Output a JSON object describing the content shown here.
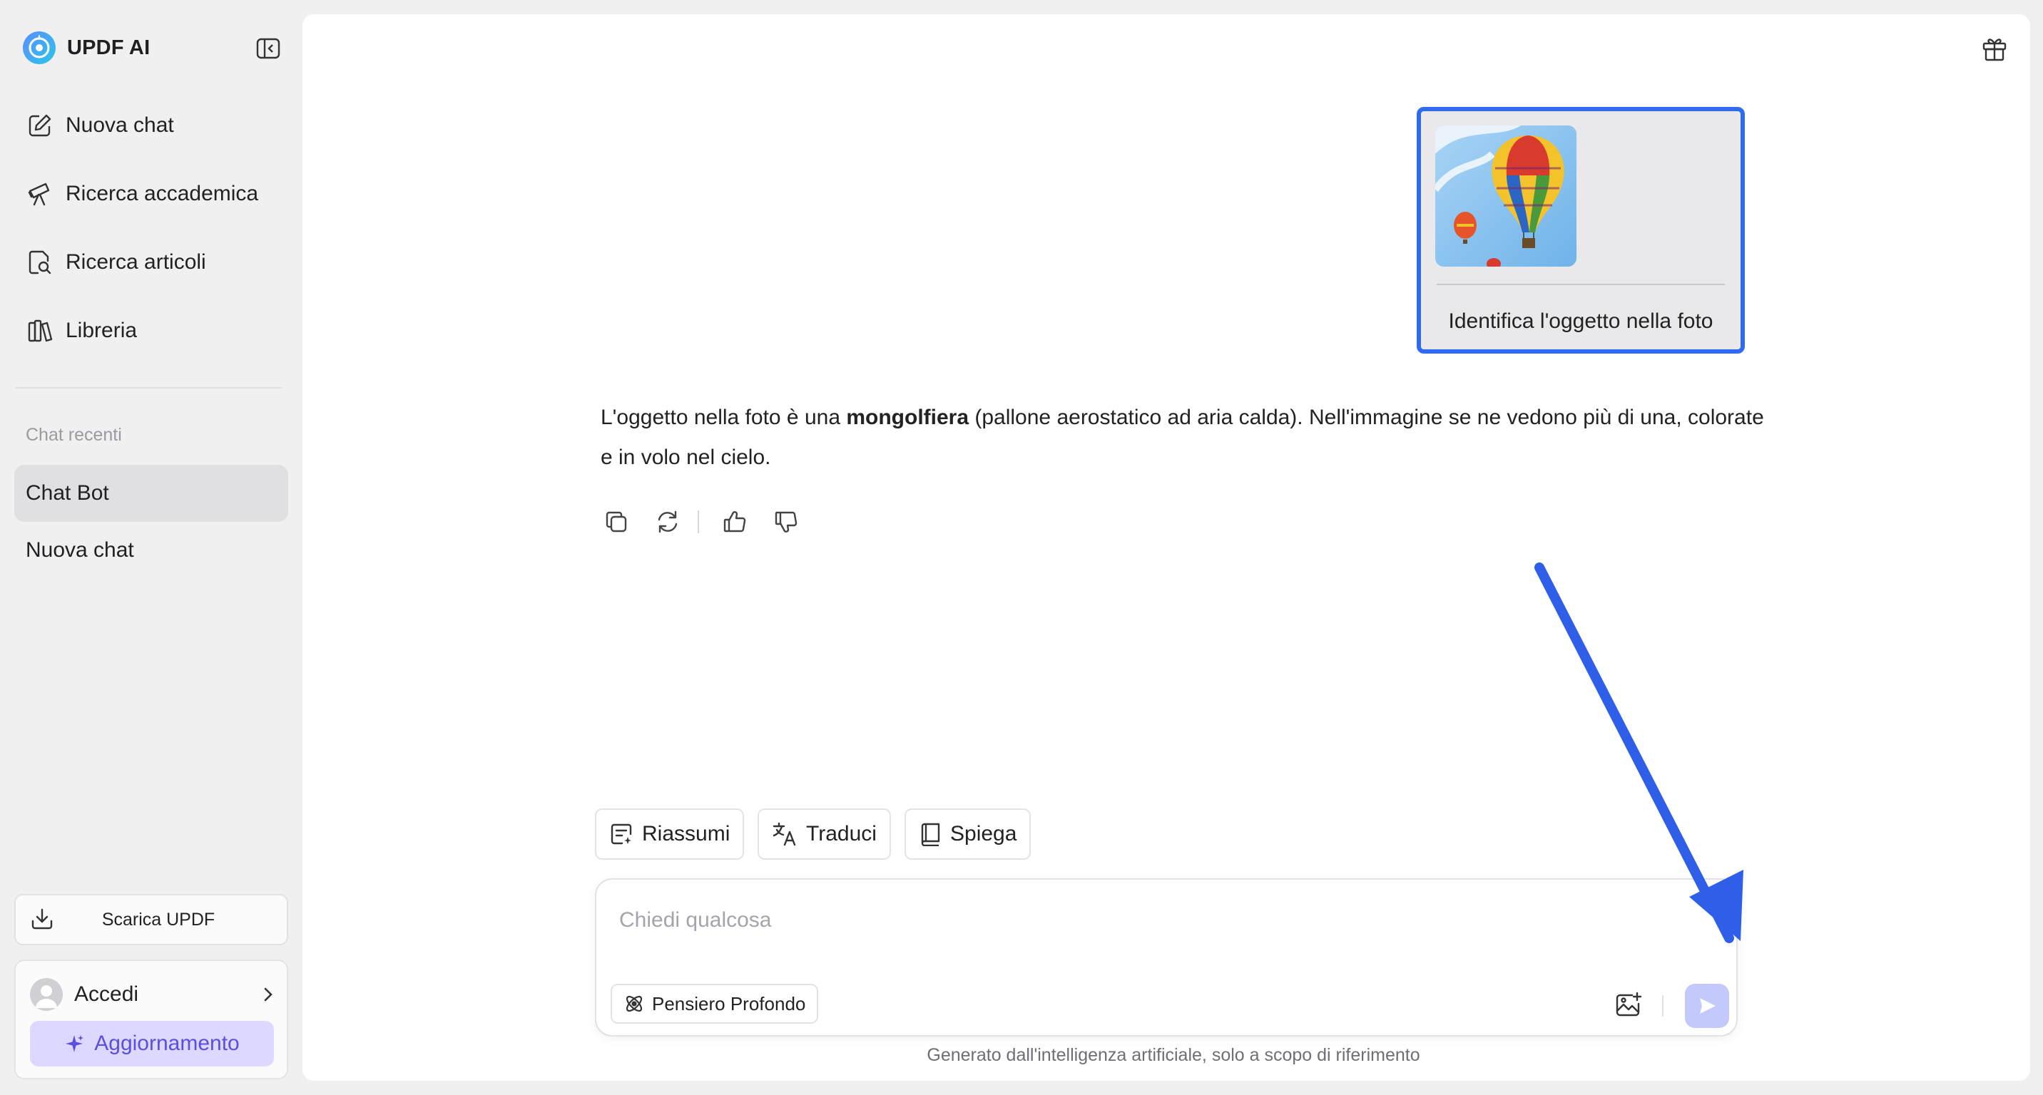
{
  "sidebar": {
    "brand": "UPDF AI",
    "nav": [
      {
        "label": "Nuova chat",
        "icon": "edit-icon"
      },
      {
        "label": "Ricerca accademica",
        "icon": "telescope-icon"
      },
      {
        "label": "Ricerca articoli",
        "icon": "document-search-icon"
      },
      {
        "label": "Libreria",
        "icon": "library-icon"
      }
    ],
    "recent_title": "Chat recenti",
    "recent": [
      "Chat Bot",
      "Nuova chat"
    ],
    "download_label": "Scarica UPDF",
    "login_label": "Accedi",
    "upgrade_label": "Aggiornamento"
  },
  "conversation": {
    "user_message": "Identifica l'oggetto nella foto",
    "answer_prefix": "L'oggetto nella foto è una ",
    "answer_bold": "mongolfiera",
    "answer_suffix": " (pallone aerostatico ad aria calda). Nell'immagine se ne vedono più di una, colorate e in volo nel cielo."
  },
  "quick_actions": {
    "summarize": "Riassumi",
    "translate": "Traduci",
    "explain": "Spiega"
  },
  "composer": {
    "placeholder": "Chiedi qualcosa",
    "deep_think": "Pensiero Profondo"
  },
  "disclaimer": "Generato dall'intelligenza artificiale, solo a scopo di riferimento",
  "colors": {
    "accent": "#2f6bef",
    "upgrade_bg": "#dcd8ff",
    "upgrade_text": "#5a4fe0",
    "send_bg": "#c4c9fb"
  }
}
